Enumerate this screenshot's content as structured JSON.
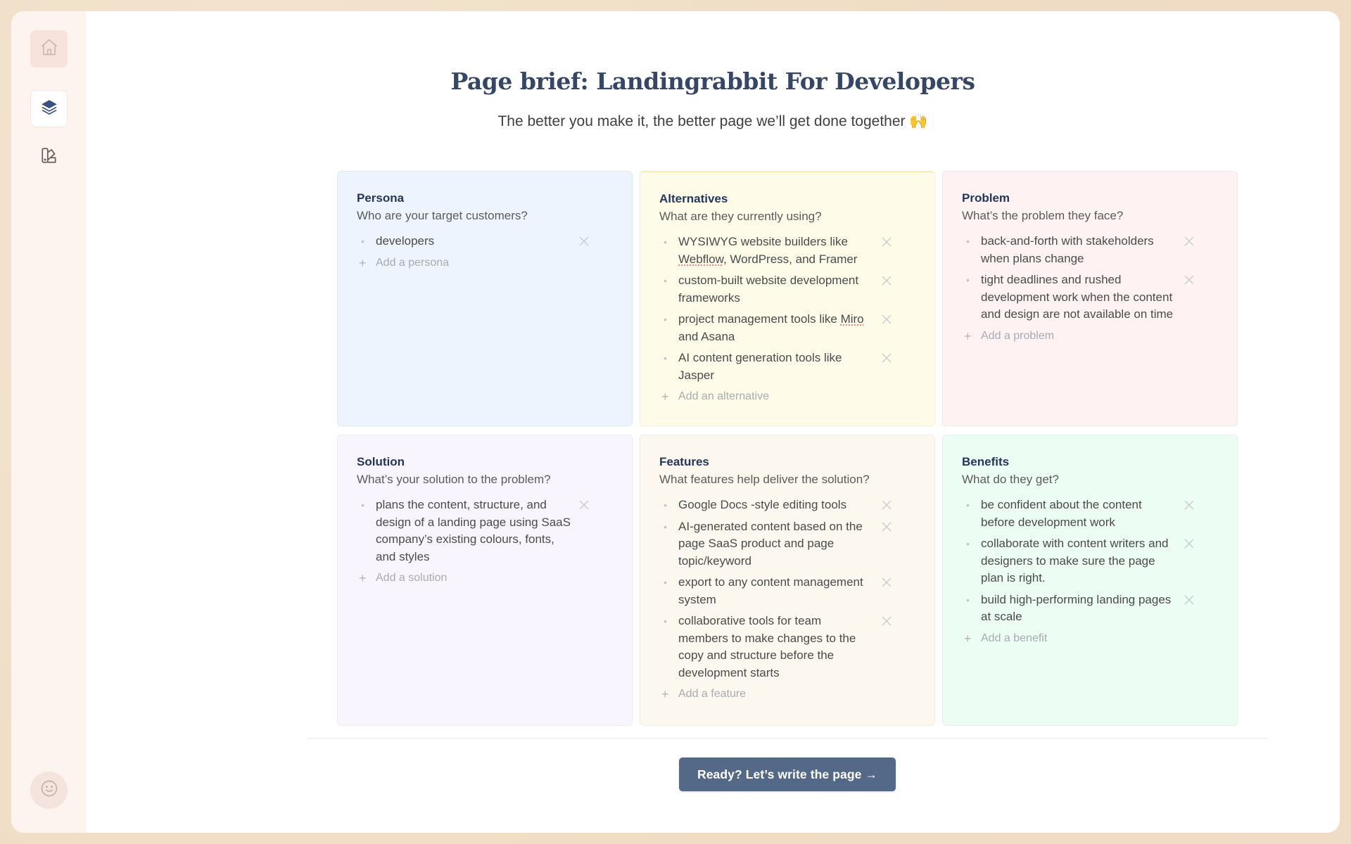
{
  "sidebar": {
    "items": [
      {
        "name": "home",
        "icon": "home-icon",
        "active": false
      },
      {
        "name": "page-briefs",
        "icon": "layers-icon",
        "active": true
      },
      {
        "name": "brand-styles",
        "icon": "palette-swatch-icon",
        "active": false
      }
    ],
    "avatar_icon": "smiley-face-icon"
  },
  "header": {
    "title": "Page brief: Landingrabbit For Developers",
    "subtitle": "The better you make it, the better page we’ll get done together 🙌"
  },
  "colors": {
    "accent": "#546888",
    "title": "#364666",
    "card_heading": "#23365e",
    "persona_bg": "#edf4fe",
    "alternatives_bg": "#fefce8",
    "problem_bg": "#fef3f2",
    "solution_bg": "#f9f5fe",
    "features_bg": "#fdf8ef",
    "benefits_bg": "#ecfdf4"
  },
  "cards": [
    {
      "key": "persona",
      "title": "Persona",
      "question": "Who are your target customers?",
      "items": [
        "developers"
      ],
      "add_label": "Add a persona"
    },
    {
      "key": "alternatives",
      "title": "Alternatives",
      "question": "What are they currently using?",
      "items": [
        "WYSIWYG website builders like Webflow, WordPress, and Framer",
        "custom-built website development frameworks",
        "project management tools like Miro and Asana",
        "AI content generation tools like Jasper"
      ],
      "add_label": "Add an alternative"
    },
    {
      "key": "problem",
      "title": "Problem",
      "question": "What’s the problem they face?",
      "items": [
        "back-and-forth with stakeholders when plans change",
        "tight deadlines and rushed development work when the content and design are not available on time"
      ],
      "add_label": "Add a problem"
    },
    {
      "key": "solution",
      "title": "Solution",
      "question": "What’s your solution to the problem?",
      "items": [
        "plans the content, structure, and design of a landing page using SaaS company’s existing colours, fonts, and styles"
      ],
      "add_label": "Add a solution"
    },
    {
      "key": "features",
      "title": "Features",
      "question": "What features help deliver the solution?",
      "items": [
        "Google Docs -style editing tools",
        "AI-generated content based on the page SaaS product and page topic/keyword",
        "export to any content management system",
        "collaborative tools for team members to make changes to the copy and structure before the development starts"
      ],
      "add_label": "Add a feature"
    },
    {
      "key": "benefits",
      "title": "Benefits",
      "question": "What do they get?",
      "items": [
        "be confident about the content before development work",
        "collaborate with content writers and designers to make sure the page plan is right.",
        "build high-performing landing pages at scale"
      ],
      "add_label": "Add a benefit"
    }
  ],
  "footer": {
    "cta_label": "Ready? Let’s write the page →"
  }
}
